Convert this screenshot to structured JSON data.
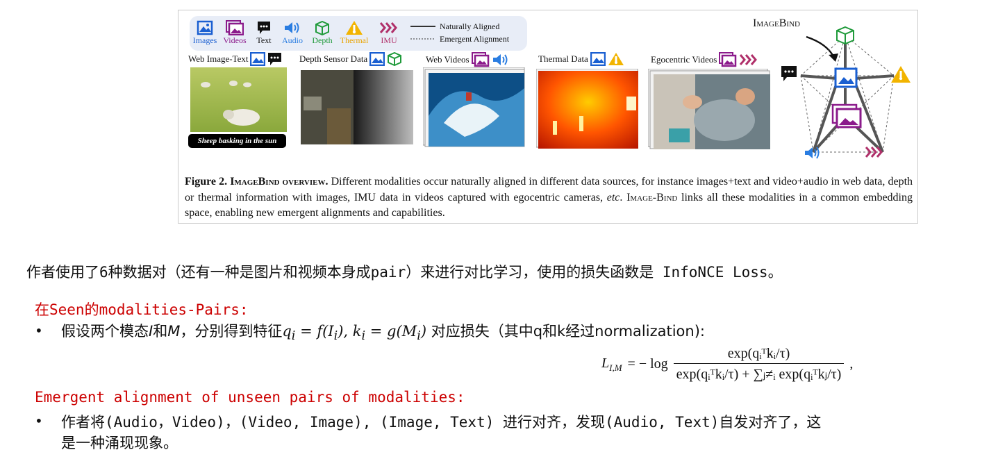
{
  "figure": {
    "legend": {
      "modalities": [
        {
          "label": "Images",
          "color": "#1a5fd1",
          "icon": "image-icon"
        },
        {
          "label": "Videos",
          "color": "#8b1a8b",
          "icon": "video-icon"
        },
        {
          "label": "Text",
          "color": "#111111",
          "icon": "speech-bubble-icon"
        },
        {
          "label": "Audio",
          "color": "#2a7de1",
          "icon": "speaker-icon"
        },
        {
          "label": "Depth",
          "color": "#1f9a3a",
          "icon": "cube-icon"
        },
        {
          "label": "Thermal",
          "color": "#e8a300",
          "icon": "thermometer-warning-icon"
        },
        {
          "label": "IMU",
          "color": "#b0306a",
          "icon": "chevrons-icon"
        }
      ],
      "naturally_aligned": "Naturally Aligned",
      "emergent_alignment": "Emergent Alignment"
    },
    "panels": [
      {
        "label": "Web Image-Text"
      },
      {
        "label": "Depth Sensor Data"
      },
      {
        "label": "Web Videos"
      },
      {
        "label": "Thermal Data"
      },
      {
        "label": "Egocentric Videos"
      }
    ],
    "image_caption": "Sheep basking in the sun",
    "imagebind_title": "ImageBind",
    "caption": {
      "prefix": "Figure 2.",
      "title": "ImageBind overview.",
      "body_1": " Different modalities occur naturally aligned in different data sources, for instance images+text and video+audio in web data, depth or thermal information with images, IMU data in videos captured with egocentric cameras, ",
      "etc": "etc",
      "body_2": ". ",
      "name_1": "Image-",
      "name_2": "Bind",
      "body_3": " links all these modalities in a common embedding space, enabling new emergent alignments and capabilities."
    }
  },
  "notes": {
    "intro": "作者使用了6种数据对（还有一种是图片和视频本身成pair）来进行对比学习，使用的损失函数是 InfoNCE Loss。",
    "section1_title": "在Seen的modalities-Pairs:",
    "section1_bullet_a": "假设两个模态",
    "section1_I": "I",
    "section1_and": "和",
    "section1_M": "M",
    "section1_bullet_b": "，分别得到特征",
    "section1_math_q": "q",
    "section1_math_q_eq": " = f(I",
    "section1_math_sep": "), k",
    "section1_math_k_eq": " = g(M",
    "section1_math_end": ")",
    "section1_bullet_c": " 对应损失（其中q和k经过normalization):",
    "formula_lhs": "L",
    "formula_lhs_sub": "I,M",
    "formula_eq": "= − log",
    "formula_num": "exp(qᵢᵀkᵢ/τ)",
    "formula_den": "exp(qᵢᵀkᵢ/τ) + ∑ⱼ≠ᵢ exp(qᵢᵀkⱼ/τ)",
    "formula_tail": ",",
    "section2_title": "Emergent alignment of unseen pairs of modalities:",
    "section2_line1": "作者将(Audio，Video)，(Video, Image), (Image, Text) 进行对齐，发现(Audio, Text)自发对齐了，这",
    "section2_line2": "是一种涌现现象。",
    "bullet_symbol": "•",
    "sub_i": "i"
  }
}
